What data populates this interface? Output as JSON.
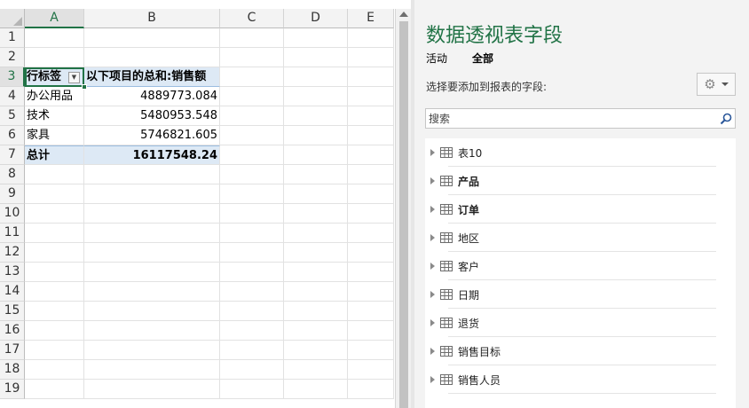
{
  "spreadsheet": {
    "columns": [
      "A",
      "B",
      "C",
      "D",
      "E"
    ],
    "rows": [
      "1",
      "2",
      "3",
      "4",
      "5",
      "6",
      "7",
      "8",
      "9",
      "10",
      "11",
      "12",
      "13",
      "14",
      "15",
      "16",
      "17",
      "18",
      "19"
    ],
    "pivot": {
      "header_label": "行标签",
      "header_value": "以下项目的总和:销售额",
      "items": [
        {
          "label": "办公用品",
          "value": "4889773.084"
        },
        {
          "label": "技术",
          "value": "5480953.548"
        },
        {
          "label": "家具",
          "value": "5746821.605"
        }
      ],
      "total_label": "总计",
      "total_value": "16117548.24"
    }
  },
  "pane": {
    "title": "数据透视表字段",
    "tabs": [
      "活动",
      "全部"
    ],
    "active_tab": "全部",
    "hint": "选择要添加到报表的字段:",
    "search_placeholder": "搜索",
    "fields": [
      {
        "label": "表10",
        "bold": false
      },
      {
        "label": "产品",
        "bold": true
      },
      {
        "label": "订单",
        "bold": true
      },
      {
        "label": "地区",
        "bold": false
      },
      {
        "label": "客户",
        "bold": false
      },
      {
        "label": "日期",
        "bold": false
      },
      {
        "label": "退货",
        "bold": false
      },
      {
        "label": "销售目标",
        "bold": false
      },
      {
        "label": "销售人员",
        "bold": false
      }
    ]
  },
  "colors": {
    "accent": "#217346",
    "pivot_band": "#dde9f5"
  }
}
